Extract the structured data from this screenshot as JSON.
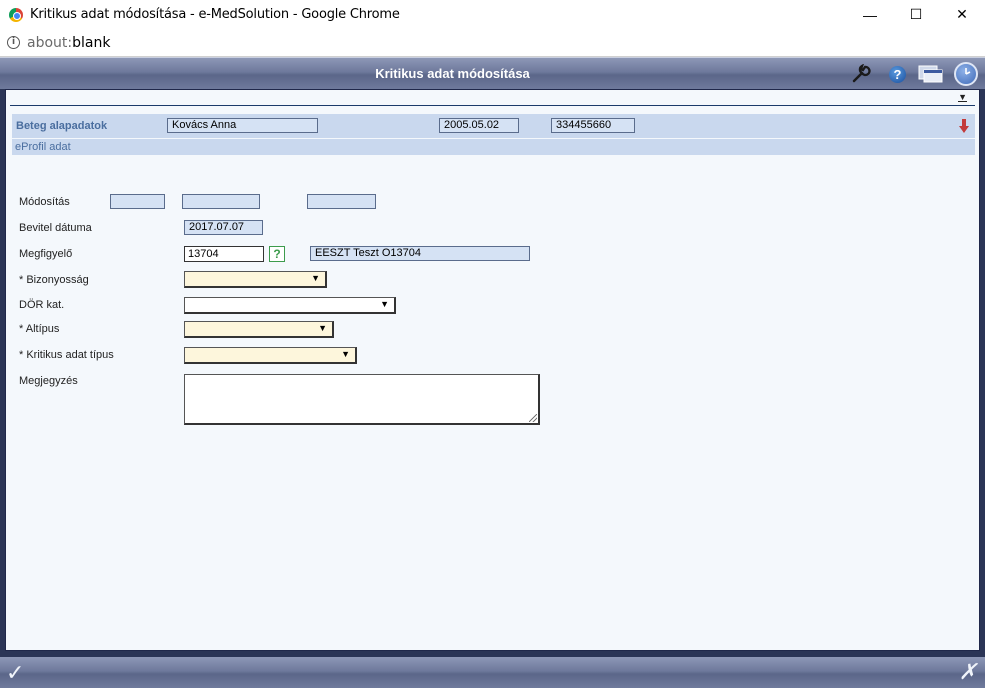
{
  "window": {
    "title": "Kritikus adat módosítása - e-MedSolution - Google Chrome",
    "minimize": "—",
    "maximize": "☐",
    "close": "✕"
  },
  "address": {
    "scheme": "about:",
    "host": "blank"
  },
  "app": {
    "title": "Kritikus adat módosítása"
  },
  "patient": {
    "section_label": "Beteg alapadatok",
    "name": "Kovács Anna",
    "birth_date": "2005.05.02",
    "taj": "334455660"
  },
  "eprofil": {
    "section_label": "eProfil adat"
  },
  "form": {
    "modositas_label": "Módosítás",
    "modositas_values": [
      "",
      "",
      ""
    ],
    "bevitel_label": "Bevitel dátuma",
    "bevitel_value": "2017.07.07",
    "megfigyelo_label": "Megfigyelő",
    "megfigyelo_code": "13704",
    "megfigyelo_help": "?",
    "megfigyelo_name": "EESZT Teszt O13704",
    "bizonyossag_label": "* Bizonyosság",
    "bizonyossag_value": "",
    "dor_label": "DÖR kat.",
    "dor_value": "",
    "altipus_label": "* Altípus",
    "altipus_value": "",
    "kritikus_tipus_label": "* Kritikus adat típus",
    "kritikus_tipus_value": "",
    "megjegyzes_label": "Megjegyzés",
    "megjegyzes_value": ""
  },
  "icons": {
    "wrench": "wrench-icon",
    "help": "?",
    "windows": "windows-icon",
    "clock": "clock-icon",
    "down_arrow": "arrow-down-icon",
    "ok": "✓",
    "cancel": "✗",
    "select_arrow": "▼",
    "collapse": "▼"
  },
  "colors": {
    "header_bar": "#6e799c",
    "content_bg": "#f4f8fc",
    "section_bg": "#c9d8ee",
    "required_select": "#fdf6dc",
    "section_text": "#4a6e9f"
  }
}
